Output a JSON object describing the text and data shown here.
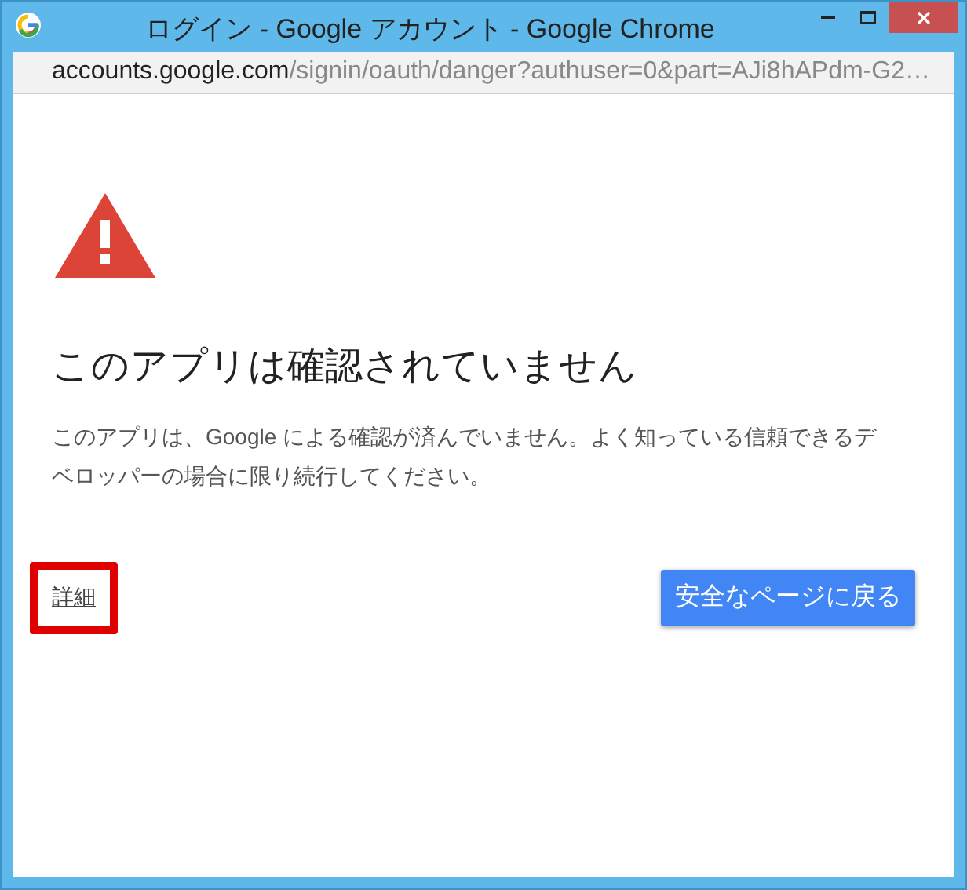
{
  "window": {
    "title": "ログイン - Google アカウント - Google Chrome"
  },
  "address_bar": {
    "host": "accounts.google.com",
    "path": "/signin/oauth/danger?authuser=0&part=AJi8hAPdm-G2…"
  },
  "page": {
    "heading": "このアプリは確認されていません",
    "message": "このアプリは、Google による確認が済んでいません。よく知っている信頼できるデベロッパーの場合に限り続行してください。",
    "details_link": {
      "label": "詳細",
      "highlighted": true
    },
    "back_button": {
      "label": "安全なページに戻る"
    }
  }
}
